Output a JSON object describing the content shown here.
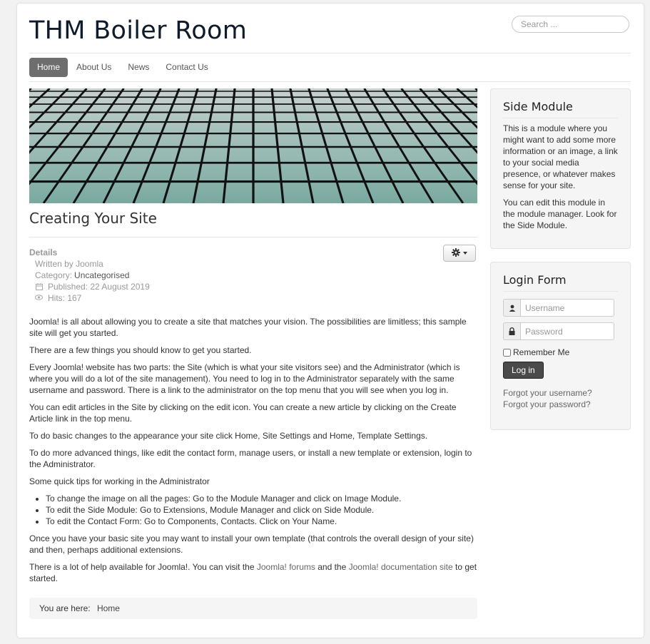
{
  "site": {
    "title": "THM Boiler Room"
  },
  "search": {
    "placeholder": "Search ..."
  },
  "nav": {
    "items": [
      "Home",
      "About Us",
      "News",
      "Contact Us"
    ]
  },
  "article": {
    "title": "Creating Your Site",
    "details_label": "Details",
    "written_by": "Written by Joomla",
    "category_label": "Category:",
    "category": "Uncategorised",
    "published": "Published: 22 August 2019",
    "hits": "Hits: 167",
    "paragraphs": [
      "Joomla! is all about allowing you to create a site that matches your vision. The possibilities are limitless; this sample site will get you started.",
      "There are a few things you should know to get you started.",
      "Every Joomla! website has two parts: the Site (which is what your site visitors see) and the Administrator (which is where you will do a lot of the site management). You need to log in to the Administrator separately with the same username and password. There is a link to the administrator on the top menu that you will see when you log in.",
      "You can edit articles in the Site by clicking on the edit icon. You can create a new article by clicking on the Create Article link in the top menu.",
      "To do basic changes to the appearance your site click Home, Site Settings and Home, Template Settings.",
      "To do more advanced things, like edit the contact form, manage users, or install a new template or extension, login to the Administrator.",
      "Some quick tips for working in the Administrator"
    ],
    "tips": [
      "To change the image on all the pages: Go to the Module Manager and click on Image Module.",
      "To edit the Side Module: Go to Extensions, Module Manager and click on Side Module.",
      "To edit the Contact Form: Go to Components, Contacts. Click on Your Name."
    ],
    "closing": "Once you have your basic site you may want to install your own template (that controls the overall design of your site) and then, perhaps additional extensions.",
    "help_prefix": "There is a lot of help available for Joomla!. You can visit the ",
    "help_link1": "Joomla! forums",
    "help_middle": " and the ",
    "help_link2": "Joomla! documentation site",
    "help_suffix": " to get started."
  },
  "breadcrumb": {
    "label": "You are here:",
    "home": "Home"
  },
  "side_module": {
    "title": "Side Module",
    "p1": "This is a module where you might want to add some more information or an image, a link to your social media presence, or whatever makes sense for your site.",
    "p2": "You can edit this module in the module manager. Look for the Side Module."
  },
  "login": {
    "title": "Login Form",
    "username_placeholder": "Username",
    "password_placeholder": "Password",
    "remember": "Remember Me",
    "button": "Log in",
    "forgot_username": "Forgot your username?",
    "forgot_password": "Forgot your password?"
  }
}
